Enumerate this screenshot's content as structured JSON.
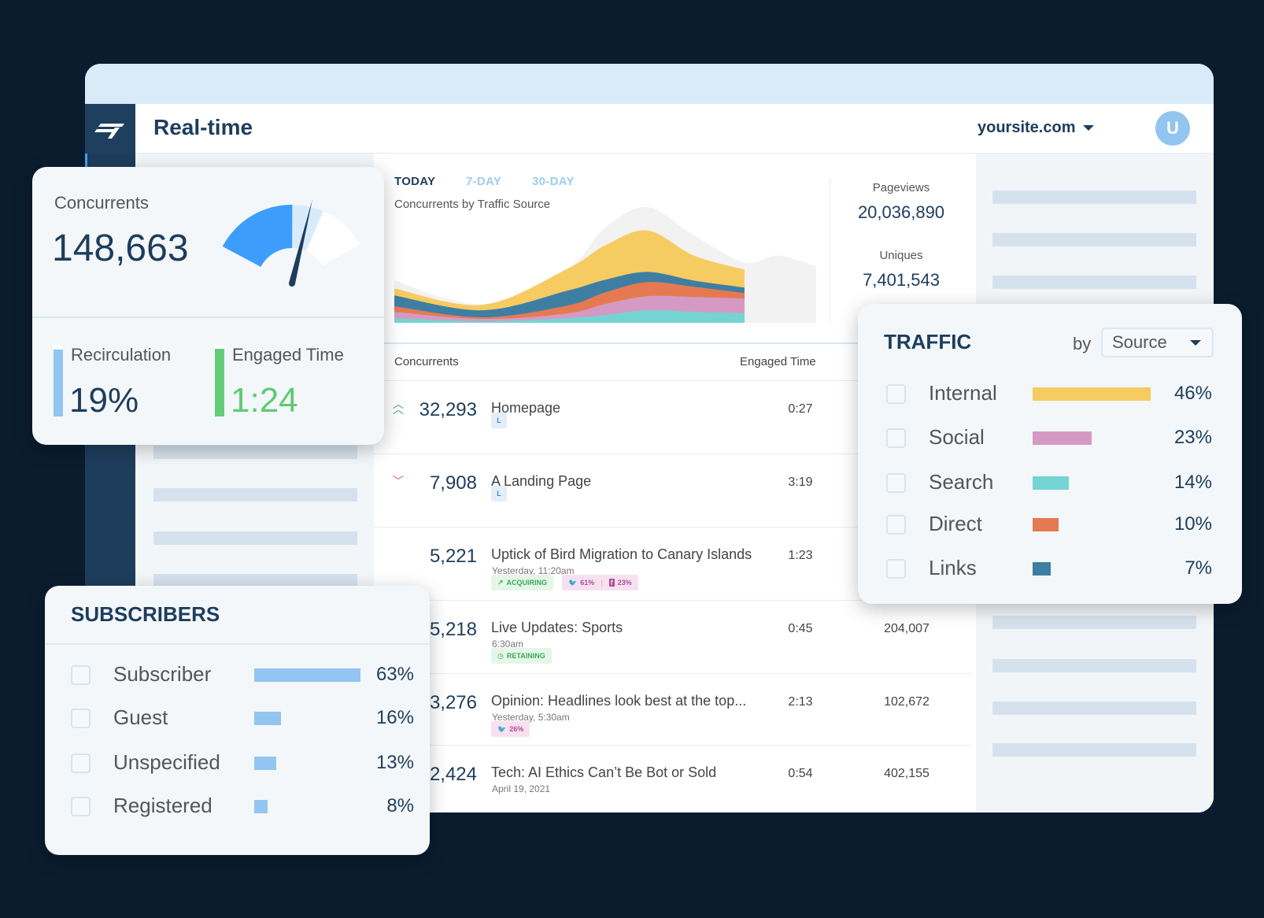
{
  "header": {
    "title": "Real-time",
    "site": "yoursite.com",
    "avatar_letter": "U"
  },
  "tabs": [
    {
      "label": "TODAY",
      "active": true
    },
    {
      "label": "7-DAY",
      "active": false
    },
    {
      "label": "30-DAY",
      "active": false
    }
  ],
  "chart_data": {
    "type": "area",
    "title": "Concurrents by Traffic Source",
    "stacked": true,
    "x": [
      0,
      21,
      41,
      50,
      60,
      71,
      83,
      91,
      100
    ],
    "series": [
      {
        "key": "search",
        "color": "#74d4d3",
        "values": [
          6,
          2,
          6,
          10,
          16,
          14,
          12,
          null,
          null
        ]
      },
      {
        "key": "social",
        "color": "#d59ac4",
        "values": [
          8,
          3,
          6,
          14,
          18,
          19,
          19,
          null,
          null
        ]
      },
      {
        "key": "direct",
        "color": "#e57a52",
        "values": [
          7,
          2,
          10,
          15,
          18,
          13,
          7,
          null,
          null
        ]
      },
      {
        "key": "links",
        "color": "#3f7ea3",
        "values": [
          14,
          9,
          19,
          16,
          13,
          8,
          7,
          null,
          null
        ]
      },
      {
        "key": "internal",
        "color": "#f6cb61",
        "values": [
          9,
          7,
          28,
          44,
          53,
          32,
          23,
          null,
          null
        ]
      }
    ],
    "projection": {
      "color": "#f2f2f2",
      "values": [
        54,
        24,
        69,
        122,
        148,
        112,
        77,
        86,
        72
      ]
    },
    "ylim": [
      0,
      150
    ]
  },
  "stats": {
    "pageviews_label": "Pageviews",
    "pageviews": "20,036,890",
    "uniques_label": "Uniques",
    "uniques": "7,401,543"
  },
  "table": {
    "headers": {
      "concurrents": "Concurrents",
      "engaged": "Engaged Time"
    },
    "rows": [
      {
        "trend": "up",
        "concurrents": "32,293",
        "title": "Homepage",
        "engaged": "0:27",
        "tags": [
          {
            "type": "l",
            "text": "L"
          }
        ]
      },
      {
        "trend": "down",
        "concurrents": "7,908",
        "title": "A Landing Page",
        "engaged": "3:19",
        "tags": [
          {
            "type": "l",
            "text": "L"
          }
        ]
      },
      {
        "concurrents": "5,221",
        "title": "Uptick of Bird Migration to Canary Islands",
        "date": "Yesterday, 11:20am",
        "engaged": "1:23",
        "tags": [
          {
            "type": "g",
            "icon": "↗",
            "text": "ACQUIRING"
          },
          {
            "type": "p",
            "icon": "🐦",
            "text": "61%",
            "icon2": "f",
            "text2": "23%"
          }
        ]
      },
      {
        "concurrents": "5,218",
        "title": "Live Updates: Sports",
        "date": "6:30am",
        "engaged": "0:45",
        "last": "204,007",
        "tags": [
          {
            "type": "g",
            "icon": "◷",
            "text": "RETAINING"
          }
        ]
      },
      {
        "concurrents": "3,276",
        "title": "Opinion: Headlines look best at the top...",
        "date": "Yesterday, 5:30am",
        "engaged": "2:13",
        "last": "102,672",
        "tags": [
          {
            "type": "p",
            "icon": "🐦",
            "text": "26%"
          }
        ]
      },
      {
        "concurrents": "2,424",
        "title": "Tech: AI Ethics Can’t Be Bot or Sold",
        "date": "April 19, 2021",
        "engaged": "0:54",
        "last": "402,155"
      }
    ]
  },
  "concurrents_card": {
    "label": "Concurrents",
    "value": "148,663",
    "gauge": {
      "fill": 0.51,
      "secondary": 0.7,
      "needle": 0.62
    },
    "recirculation": {
      "label": "Recirculation",
      "value": "19%",
      "level": 0.93
    },
    "engaged": {
      "label": "Engaged Time",
      "value": "1:24",
      "level": 0.95
    }
  },
  "traffic": {
    "title": "TRAFFIC",
    "by": "by",
    "select": "Source",
    "items": [
      {
        "label": "Internal",
        "pct": "46%",
        "value": 46,
        "color": "#f6cb61"
      },
      {
        "label": "Social",
        "pct": "23%",
        "value": 23,
        "color": "#d59ac4"
      },
      {
        "label": "Search",
        "pct": "14%",
        "value": 14,
        "color": "#74d4d3"
      },
      {
        "label": "Direct",
        "pct": "10%",
        "value": 10,
        "color": "#e57a52"
      },
      {
        "label": "Links",
        "pct": "7%",
        "value": 7,
        "color": "#3f7ea3"
      }
    ]
  },
  "subscribers": {
    "title": "SUBSCRIBERS",
    "color": "#92c5ef",
    "items": [
      {
        "label": "Subscriber",
        "pct": "63%",
        "value": 63
      },
      {
        "label": "Guest",
        "pct": "16%",
        "value": 16
      },
      {
        "label": "Unspecified",
        "pct": "13%",
        "value": 13
      },
      {
        "label": "Registered",
        "pct": "8%",
        "value": 8
      }
    ]
  }
}
